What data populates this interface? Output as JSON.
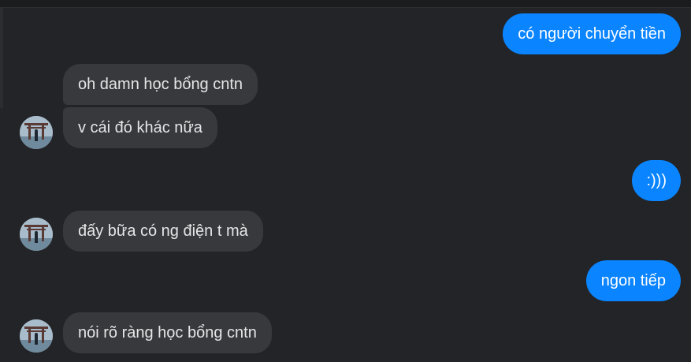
{
  "messages": [
    {
      "id": "m1",
      "direction": "outgoing",
      "text": "có người chuyển tiền"
    },
    {
      "id": "m2",
      "direction": "incoming",
      "text": "oh damn học bổng cntn"
    },
    {
      "id": "m3",
      "direction": "incoming",
      "text": "v cái đó khác nữa"
    },
    {
      "id": "m4",
      "direction": "outgoing",
      "text": ":)))"
    },
    {
      "id": "m5",
      "direction": "incoming",
      "text": "đấy bữa có ng điện t mà"
    },
    {
      "id": "m6",
      "direction": "outgoing",
      "text": "ngon tiếp"
    },
    {
      "id": "m7",
      "direction": "incoming",
      "text": "nói rõ ràng học bổng cntn"
    }
  ],
  "colors": {
    "background": "#232427",
    "outgoing_bubble": "#0a84ff",
    "incoming_bubble": "#38393c",
    "incoming_text": "#e6e6e8",
    "outgoing_text": "#ffffff"
  },
  "avatar_icon": "profile-photo-icon"
}
